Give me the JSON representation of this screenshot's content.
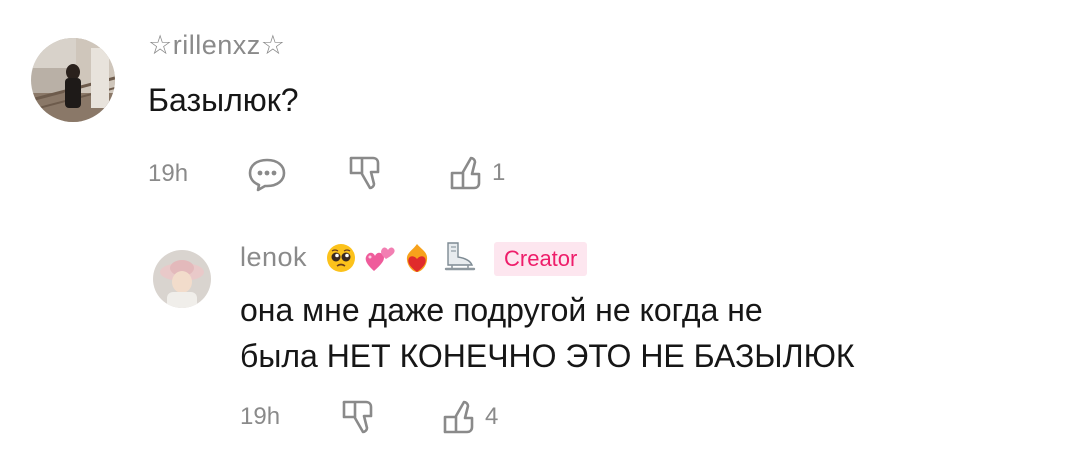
{
  "comment": {
    "username": "☆rillenxz☆",
    "text": "Базылюк?",
    "time": "19h",
    "like_count": "1",
    "avatar": "avatar-photo-stairs"
  },
  "reply": {
    "username": "lenok",
    "emojis": [
      "pleading-face-emoji",
      "two-hearts-emoji",
      "heart-on-fire-emoji",
      "ice-skate-emoji"
    ],
    "badge": "Creator",
    "text_line1": "она мне даже подругой не когда не",
    "text_line2": "была НЕТ КОНЕЧНО ЭТО НЕ БАЗЫЛЮК",
    "time": "19h",
    "like_count": "4",
    "avatar": "avatar-photo-hat"
  },
  "colors": {
    "meta_gray": "#8a8a8a",
    "text": "#161616",
    "badge_text": "#ee1d6a",
    "badge_bg": "#fde6ef"
  }
}
